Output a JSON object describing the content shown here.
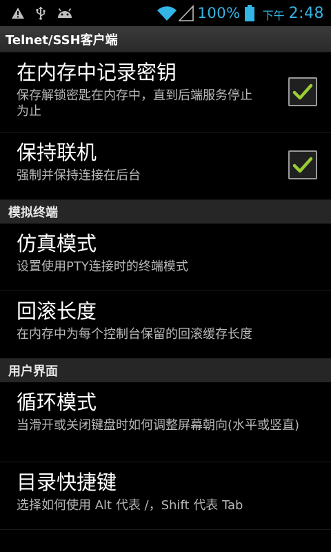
{
  "status_bar": {
    "icons_left": [
      "warning-icon",
      "usb-icon",
      "android-icon"
    ],
    "battery_percent": "100%",
    "ampm": "下午",
    "time": "2:48",
    "accent_color": "#33b5e5"
  },
  "header": {
    "title": "Telnet/SSH客户端"
  },
  "prefs": {
    "remember_key": {
      "title": "在内存中记录密钥",
      "summary": "保存解锁密匙在内存中，直到后端服务停止为止",
      "checked": true
    },
    "keep_alive": {
      "title": "保持联机",
      "summary": "强制并保持连接在后台",
      "checked": true
    },
    "emulation_mode": {
      "title": "仿真模式",
      "summary": "设置使用PTY连接时的终端模式"
    },
    "scrollback": {
      "title": "回滚长度",
      "summary": "在内存中为每个控制台保留的回滚缓存长度"
    },
    "rotation_mode": {
      "title": "循环模式",
      "summary": "当滑开或关闭键盘时如何调整屏幕朝向(水平或竖直)"
    },
    "dir_shortcuts": {
      "title": "目录快捷键",
      "summary": "选择如何使用 Alt 代表 /，Shift 代表 Tab"
    }
  },
  "categories": {
    "terminal_emulation": "模拟终端",
    "user_interface": "用户界面"
  },
  "check_color": "#9acd32"
}
